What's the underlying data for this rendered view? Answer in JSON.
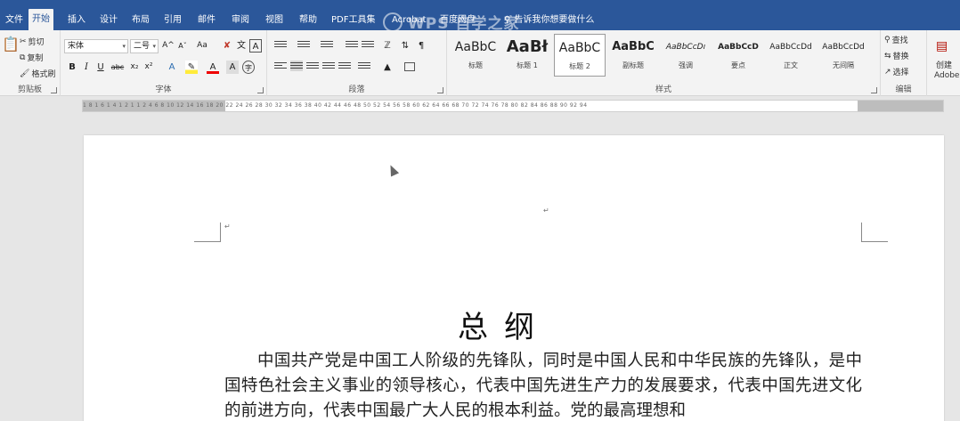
{
  "tabs": [
    {
      "label": "文件",
      "active": false
    },
    {
      "label": "开始",
      "active": true
    },
    {
      "label": "插入",
      "active": false
    },
    {
      "label": "设计",
      "active": false
    },
    {
      "label": "布局",
      "active": false
    },
    {
      "label": "引用",
      "active": false
    },
    {
      "label": "邮件",
      "active": false
    },
    {
      "label": "审阅",
      "active": false
    },
    {
      "label": "视图",
      "active": false
    },
    {
      "label": "帮助",
      "active": false
    },
    {
      "label": "PDF工具集",
      "active": false
    },
    {
      "label": "Acrobat",
      "active": false
    },
    {
      "label": "百度网盘",
      "active": false
    }
  ],
  "tell_me": "告诉我你想要做什么",
  "watermark": "WPS 自学之家",
  "clipboard": {
    "cut": "剪切",
    "copy": "复制",
    "format_painter": "格式刷",
    "group_label": "剪贴板"
  },
  "font": {
    "family": "宋体",
    "size": "二号",
    "grow": "A^",
    "shrink": "Aˇ",
    "case": "Aa",
    "group_label": "字体"
  },
  "paragraph": {
    "group_label": "段落"
  },
  "styles": {
    "items": [
      {
        "sample": "AaBbC",
        "name": "标题"
      },
      {
        "sample": "AaBł",
        "name": "标题 1"
      },
      {
        "sample": "AaBbC",
        "name": "标题 2"
      },
      {
        "sample": "AaBbC",
        "name": "副标题"
      },
      {
        "sample": "AaBbCcDı",
        "name": "强调"
      },
      {
        "sample": "AaBbCcD",
        "name": "要点"
      },
      {
        "sample": "AaBbCcDd",
        "name": "正文"
      },
      {
        "sample": "AaBbCcDd",
        "name": "无间隔"
      }
    ],
    "group_label": "样式"
  },
  "editing": {
    "find": "查找",
    "replace": "替换",
    "select": "选择",
    "group_label": "编辑"
  },
  "acrobat": {
    "create": "创建",
    "name": "Adobe"
  },
  "ruler": {
    "ticks": "1 8 1 6 1 4 1 2 1 1 2 4 6 8 10 12 14 16 18 20 22 24 26 28 30 32 34 36 38 40 42 44 46 48 50 52 54 56 58 60 62 64 66 68 70 72 74 76 78 80 82 84 86 88 90 92 94"
  },
  "document": {
    "title": "总纲",
    "paragraph": "中国共产党是中国工人阶级的先锋队，同时是中国人民和中华民族的先锋队，是中国特色社会主义事业的领导核心，代表中国先进生产力的发展要求，代表中国先进文化的前进方向，代表中国最广大人民的根本利益。党的最高理想和"
  }
}
